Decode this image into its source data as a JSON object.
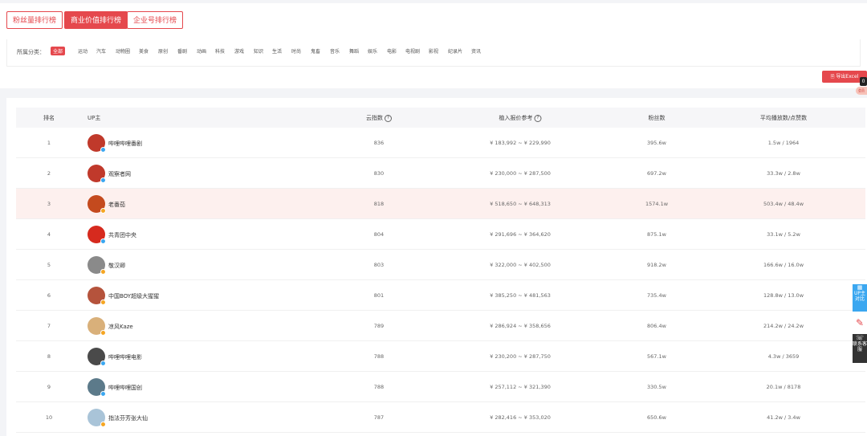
{
  "tabs": [
    {
      "label": "粉丝量排行榜",
      "active": false
    },
    {
      "label": "商业价值排行榜",
      "active": true
    },
    {
      "label": "企业号排行榜",
      "active": false
    }
  ],
  "filter": {
    "label": "所属分类：",
    "categories": [
      "全部",
      "运动",
      "汽车",
      "动物圈",
      "美食",
      "原创",
      "番剧",
      "动画",
      "科技",
      "游戏",
      "知识",
      "生活",
      "时尚",
      "鬼畜",
      "音乐",
      "舞蹈",
      "娱乐",
      "电影",
      "电视剧",
      "影视",
      "纪录片",
      "资讯"
    ],
    "active_index": 0
  },
  "export": {
    "label": "导出Excel",
    "badge": "0",
    "tip": "会员"
  },
  "table": {
    "headers": {
      "rank": "排名",
      "up": "UP主",
      "index": "云指数",
      "price": "植入报价参考",
      "fans": "粉丝数",
      "avg": "平均播放数/点赞数"
    },
    "rows": [
      {
        "rank": "1",
        "name": "哔哩哔哩番剧",
        "index": "836",
        "price": "¥ 183,992 ~ ¥ 229,990",
        "fans": "395.6w",
        "avg": "1.5w / 1964",
        "verify": "blue",
        "highlight": false,
        "avatar_color": "#c0392b"
      },
      {
        "rank": "2",
        "name": "观察者网",
        "index": "830",
        "price": "¥ 230,000 ~ ¥ 287,500",
        "fans": "697.2w",
        "avg": "33.3w / 2.8w",
        "verify": "blue",
        "highlight": false,
        "avatar_color": "#c0392b"
      },
      {
        "rank": "3",
        "name": "老番茄",
        "index": "818",
        "price": "¥ 518,650 ~ ¥ 648,313",
        "fans": "1574.1w",
        "avg": "503.4w / 48.4w",
        "verify": "orange",
        "highlight": true,
        "avatar_color": "#c44a1e"
      },
      {
        "rank": "4",
        "name": "共青团中央",
        "index": "804",
        "price": "¥ 291,696 ~ ¥ 364,620",
        "fans": "875.1w",
        "avg": "33.1w / 5.2w",
        "verify": "blue",
        "highlight": false,
        "avatar_color": "#d62a1e"
      },
      {
        "rank": "5",
        "name": "敬汉卿",
        "index": "803",
        "price": "¥ 322,000 ~ ¥ 402,500",
        "fans": "918.2w",
        "avg": "166.6w / 16.0w",
        "verify": "orange",
        "highlight": false,
        "avatar_color": "#8a8a8a"
      },
      {
        "rank": "6",
        "name": "中国BOY超级大猩猩",
        "index": "801",
        "price": "¥ 385,250 ~ ¥ 481,563",
        "fans": "735.4w",
        "avg": "128.8w / 13.0w",
        "verify": "orange",
        "highlight": false,
        "avatar_color": "#b5533c"
      },
      {
        "rank": "7",
        "name": "凉风Kaze",
        "index": "789",
        "price": "¥ 286,924 ~ ¥ 358,656",
        "fans": "806.4w",
        "avg": "214.2w / 24.2w",
        "verify": "orange",
        "highlight": false,
        "avatar_color": "#d9b07a"
      },
      {
        "rank": "8",
        "name": "哔哩哔哩电影",
        "index": "788",
        "price": "¥ 230,200 ~ ¥ 287,750",
        "fans": "567.1w",
        "avg": "4.3w / 3659",
        "verify": "blue",
        "highlight": false,
        "avatar_color": "#4a4a4a"
      },
      {
        "rank": "9",
        "name": "哔哩哔哩国创",
        "index": "788",
        "price": "¥ 257,112 ~ ¥ 321,390",
        "fans": "330.5w",
        "avg": "20.1w / 8178",
        "verify": "blue",
        "highlight": false,
        "avatar_color": "#5c7a8a"
      },
      {
        "rank": "10",
        "name": "指法芬芳张大仙",
        "index": "787",
        "price": "¥ 282,416 ~ ¥ 353,020",
        "fans": "650.6w",
        "avg": "41.2w / 3.4w",
        "verify": "orange",
        "highlight": false,
        "avatar_color": "#a9c4d8"
      }
    ]
  },
  "side": {
    "compare": "UP主对比",
    "contact": "联系客服"
  },
  "colors": {
    "accent": "#e5484d",
    "verify_blue": "#3ba7f0",
    "verify_orange": "#f5a623"
  }
}
